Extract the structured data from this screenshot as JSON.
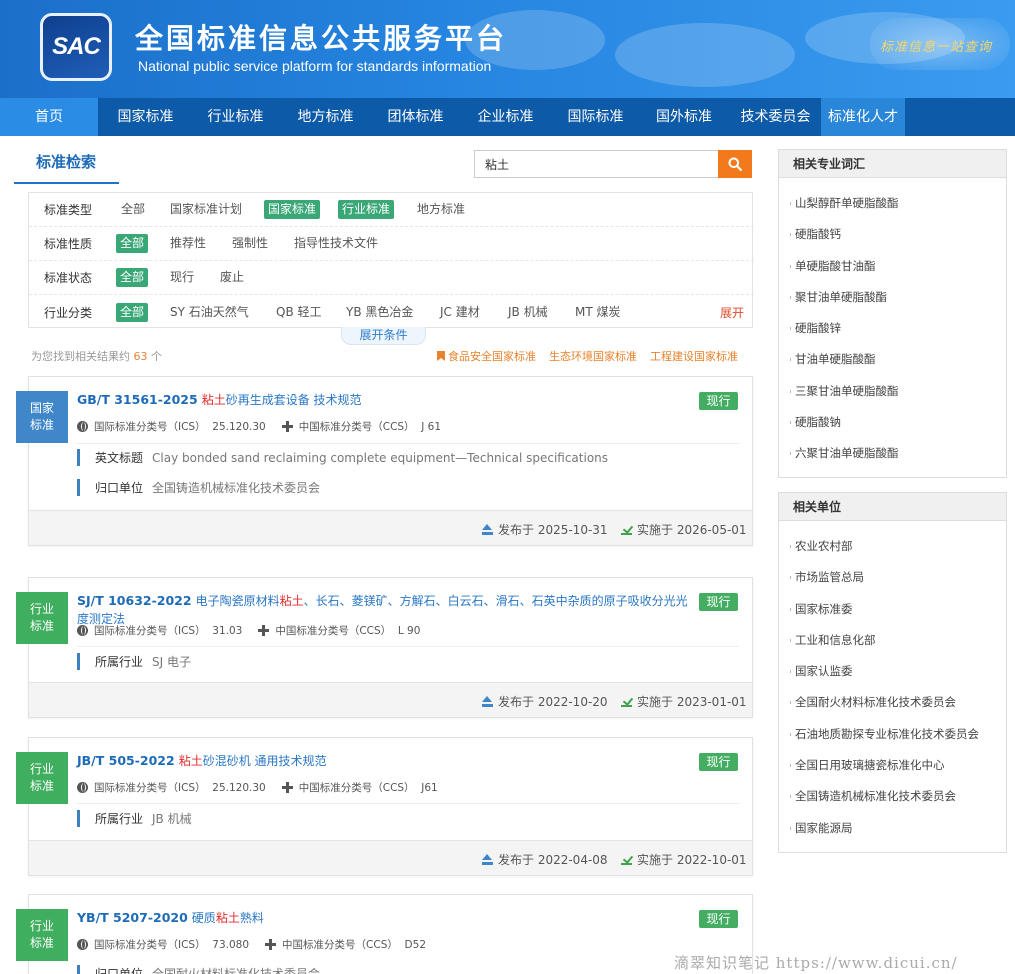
{
  "header": {
    "logo_text": "SAC",
    "title": "全国标准信息公共服务平台",
    "subtitle": "National public service platform  for standards information",
    "slogan": "标准信息一站查询"
  },
  "nav": [
    {
      "label": "首页",
      "active": true
    },
    {
      "label": "国家标准"
    },
    {
      "label": "行业标准"
    },
    {
      "label": "地方标准"
    },
    {
      "label": "团体标准"
    },
    {
      "label": "企业标准"
    },
    {
      "label": "国际标准"
    },
    {
      "label": "国外标准"
    },
    {
      "label": "技术委员会"
    },
    {
      "label": "标准化人才"
    }
  ],
  "search": {
    "tab_title": "标准检索",
    "value": "粘土",
    "button_icon": "search-icon"
  },
  "filters": {
    "type": {
      "label": "标准类型",
      "options": [
        "全部",
        "国家标准计划",
        "国家标准",
        "行业标准",
        "地方标准"
      ]
    },
    "nature": {
      "label": "标准性质",
      "options": [
        "全部",
        "推荐性",
        "强制性",
        "指导性技术文件"
      ]
    },
    "status": {
      "label": "标准状态",
      "options": [
        "全部",
        "现行",
        "废止"
      ]
    },
    "industry": {
      "label": "行业分类",
      "options": [
        "全部",
        "SY 石油天然气",
        "QB 轻工",
        "YB 黑色冶金",
        "JC 建材",
        "JB 机械",
        "MT 煤炭"
      ],
      "expand": "展开"
    },
    "expand_conditions": "展开条件"
  },
  "results": {
    "prefix": "为您找到相关结果约",
    "count": "63",
    "suffix": "个",
    "quick_links": [
      "食品安全国家标准",
      "生态环境国家标准",
      "工程建设国家标准"
    ]
  },
  "cards": [
    {
      "badge": "国家\n标准",
      "code": "GB/T 31561-2025",
      "title_pre": "",
      "title_hl": "粘土",
      "title_post": "砂再生成套设备 技术规范",
      "status": "现行",
      "ics_label": "国际标准分类号（ICS）",
      "ics": "25.120.30",
      "ccs_label": "中国标准分类号（CCS）",
      "ccs": "J 61",
      "fields": [
        {
          "label": "英文标题",
          "value": "Clay bonded sand reclaiming complete equipment—Technical specifications"
        },
        {
          "label": "归口单位",
          "value": "全国铸造机械标准化技术委员会"
        }
      ],
      "publish": "发布于 2025-10-31",
      "implement": "实施于 2026-05-01"
    },
    {
      "badge": "行业\n标准",
      "code": "SJ/T 10632-2022",
      "title_pre": "电子陶瓷原材料",
      "title_hl": "粘土",
      "title_post": "、长石、菱镁矿、方解石、白云石、滑石、石英中杂质的原子吸收分光光度测定法",
      "status": "现行",
      "ics_label": "国际标准分类号（ICS）",
      "ics": "31.03",
      "ccs_label": "中国标准分类号（CCS）",
      "ccs": "L 90",
      "fields": [
        {
          "label": "所属行业",
          "value": "SJ 电子"
        }
      ],
      "publish": "发布于 2022-10-20",
      "implement": "实施于 2023-01-01"
    },
    {
      "badge": "行业\n标准",
      "code": "JB/T 505-2022",
      "title_pre": "",
      "title_hl": "粘土",
      "title_post": "砂混砂机 通用技术规范",
      "status": "现行",
      "ics_label": "国际标准分类号（ICS）",
      "ics": "25.120.30",
      "ccs_label": "中国标准分类号（CCS）",
      "ccs": "J61",
      "fields": [
        {
          "label": "所属行业",
          "value": "JB 机械"
        }
      ],
      "publish": "发布于 2022-04-08",
      "implement": "实施于 2022-10-01"
    },
    {
      "badge": "行业\n标准",
      "code": "YB/T 5207-2020",
      "title_pre": "硬质",
      "title_hl": "粘土",
      "title_post": "熟料",
      "status": "现行",
      "ics_label": "国际标准分类号（ICS）",
      "ics": "73.080",
      "ccs_label": "中国标准分类号（CCS）",
      "ccs": "D52",
      "fields": [
        {
          "label": "归口单位",
          "value": "全国耐火材料标准化技术委员会"
        }
      ]
    }
  ],
  "sidebar": {
    "terms": {
      "title": "相关专业词汇",
      "items": [
        "山梨醇酐单硬脂酸酯",
        "硬脂酸钙",
        "单硬脂酸甘油酯",
        "聚甘油单硬脂酸酯",
        "硬脂酸锌",
        "甘油单硬脂酸酯",
        "三聚甘油单硬脂酸酯",
        "硬脂酸钠",
        "六聚甘油单硬脂酸酯"
      ]
    },
    "units": {
      "title": "相关单位",
      "items": [
        "农业农村部",
        "市场监管总局",
        "国家标准委",
        "工业和信息化部",
        "国家认监委",
        "全国耐火材料标准化技术委员会",
        "石油地质勘探专业标准化技术委员会",
        "全国日用玻璃搪瓷标准化中心",
        "全国铸造机械标准化技术委员会",
        "国家能源局"
      ]
    }
  },
  "watermark": "滴翠知识笔记 https://www.dicui.cn/",
  "colors": {
    "accent": "#1d74c9",
    "nav": "#0d5aa8",
    "search_button": "#f27a1a",
    "filter_on": "#3aa776",
    "status": "#43ad62",
    "highlight": "#e12c2c"
  }
}
